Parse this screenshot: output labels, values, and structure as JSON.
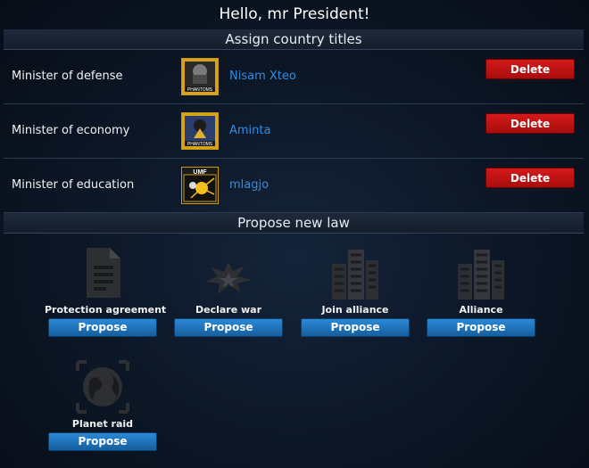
{
  "header": {
    "greeting": "Hello, mr President!"
  },
  "titles_section": {
    "heading": "Assign country titles",
    "rows": [
      {
        "title": "Minister of defense",
        "player": "Nisam Xteo",
        "avatar_text": "PHANTOMS",
        "action": "Delete"
      },
      {
        "title": "Minister of economy",
        "player": "Aminta",
        "avatar_text": "PHANTOMS",
        "action": "Delete"
      },
      {
        "title": "Minister of education",
        "player": "mlagjo",
        "avatar_text": "UMF",
        "action": "Delete"
      }
    ]
  },
  "laws_section": {
    "heading": "Propose new law",
    "laws": [
      {
        "name": "Protection agreement",
        "icon": "document-icon",
        "action": "Propose"
      },
      {
        "name": "Declare war",
        "icon": "explosion-icon",
        "action": "Propose"
      },
      {
        "name": "Join alliance",
        "icon": "buildings-icon",
        "action": "Propose"
      },
      {
        "name": "Alliance",
        "icon": "buildings-icon",
        "action": "Propose"
      },
      {
        "name": "Planet raid",
        "icon": "planet-icon",
        "action": "Propose"
      }
    ]
  },
  "colors": {
    "delete": "#c41010",
    "propose": "#1f74bd",
    "player_link": "#2f8de4"
  }
}
